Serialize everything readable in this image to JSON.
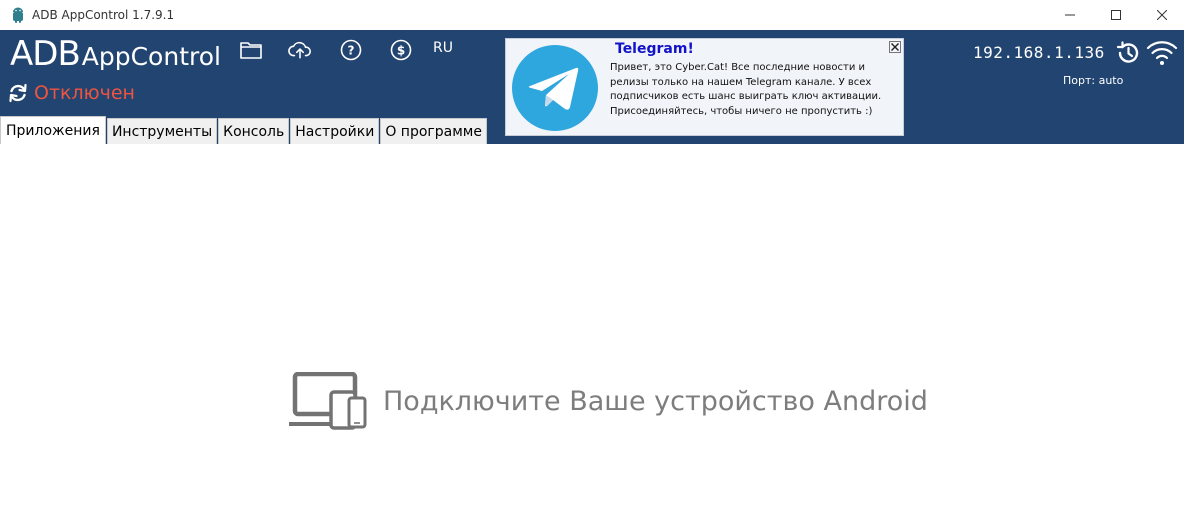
{
  "window": {
    "title": "ADB AppControl 1.7.9.1",
    "icons": [
      "android-icon",
      "minimize-icon",
      "maximize-icon",
      "close-icon"
    ]
  },
  "header": {
    "logo_adb": "ADB",
    "logo_appcontrol": "AppControl",
    "toolbar_icons": [
      "folder-icon",
      "cloud-upload-icon",
      "help-icon",
      "donate-icon"
    ],
    "language": "RU",
    "status": "Отключен",
    "ip_address": "192.168.1.136",
    "port_label": "Порт: auto"
  },
  "banner": {
    "title": "Telegram!",
    "text": "Привет, это Cyber.Cat! Все последние новости и релизы только на нашем Telegram канале. У всех подписчиков есть шанс выиграть ключ активации. Присоединяйтесь, чтобы ничего не пропустить :)"
  },
  "tabs": [
    {
      "label": "Приложения",
      "active": true
    },
    {
      "label": "Инструменты",
      "active": false
    },
    {
      "label": "Консоль",
      "active": false
    },
    {
      "label": "Настройки",
      "active": false
    },
    {
      "label": "О программе",
      "active": false
    }
  ],
  "content": {
    "empty_message": "Подключите Ваше устройство Android"
  },
  "colors": {
    "header_bg": "#224470",
    "status_disconnected": "#ee5440",
    "banner_title": "#1212c8",
    "telegram_blue": "#2ea6de",
    "empty_text": "#7d7d7d"
  }
}
